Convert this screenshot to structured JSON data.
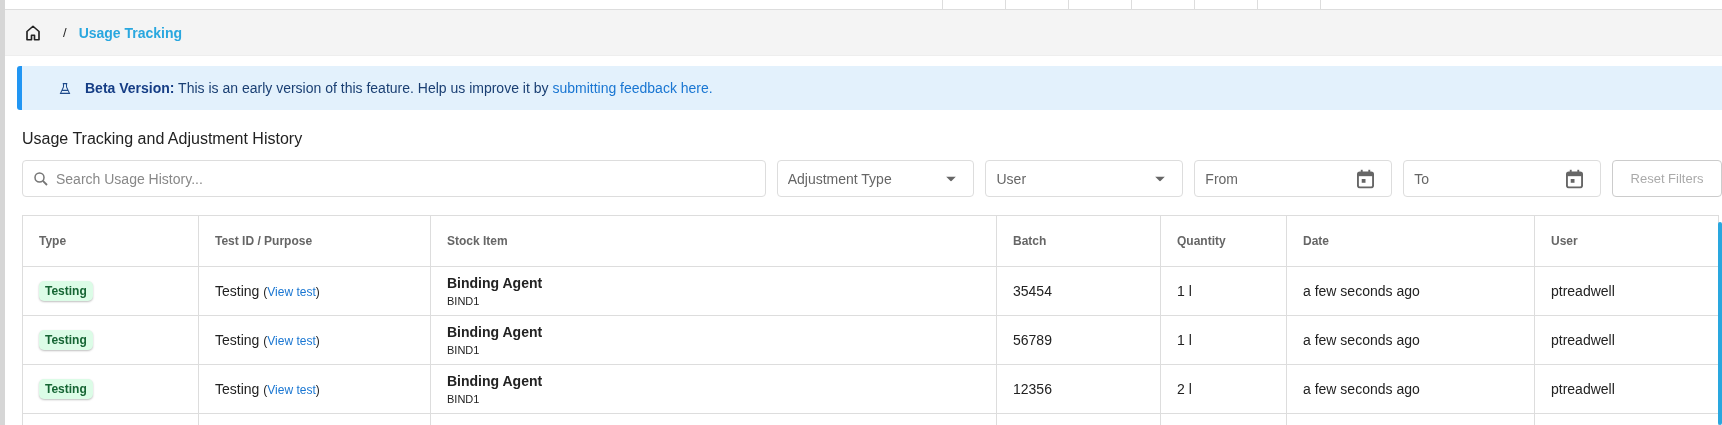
{
  "breadcrumb": {
    "current": "Usage Tracking",
    "separator": "/"
  },
  "banner": {
    "label": "Beta Version:",
    "text": "This is an early version of this feature. Help us improve it by",
    "link": "submitting feedback here."
  },
  "title": "Usage Tracking and Adjustment History",
  "filters": {
    "search": {
      "placeholder": "Search Usage History..."
    },
    "selects": [
      {
        "kind": "select",
        "placeholder": "Adjustment Type"
      },
      {
        "kind": "select",
        "placeholder": "User"
      },
      {
        "kind": "date",
        "placeholder": "From"
      },
      {
        "kind": "date",
        "placeholder": "To"
      }
    ],
    "reset": {
      "label": "Reset Filters",
      "disabled": true
    }
  },
  "table": {
    "columns": [
      "Type",
      "Test ID / Purpose",
      "Stock Item",
      "Batch",
      "Quantity",
      "Date",
      "User"
    ],
    "link_open": "(",
    "link_close": ")",
    "rows": [
      {
        "type": "Testing",
        "purpose": "Testing",
        "link": "View test",
        "item": "Binding Agent",
        "code": "BIND1",
        "batch": "35454",
        "quantity": "1 l",
        "date": "a few seconds ago",
        "user": "ptreadwell"
      },
      {
        "type": "Testing",
        "purpose": "Testing",
        "link": "View test",
        "item": "Binding Agent",
        "code": "BIND1",
        "batch": "56789",
        "quantity": "1 l",
        "date": "a few seconds ago",
        "user": "ptreadwell"
      },
      {
        "type": "Testing",
        "purpose": "Testing",
        "link": "View test",
        "item": "Binding Agent",
        "code": "BIND1",
        "batch": "12356",
        "quantity": "2 l",
        "date": "a few seconds ago",
        "user": "ptreadwell"
      }
    ]
  }
}
